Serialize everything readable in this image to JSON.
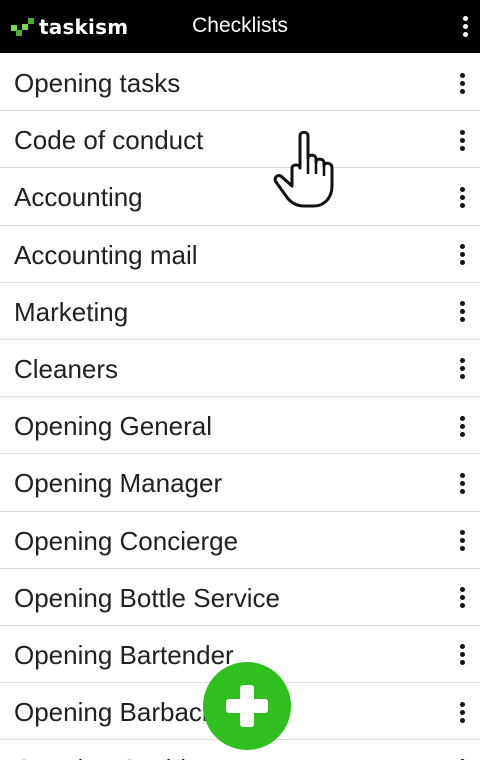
{
  "app": {
    "logo_text": "taskism",
    "title": "Checklists"
  },
  "icons": {
    "top_menu": "vertical-dots-icon",
    "row_menu": "vertical-dots-icon",
    "fab": "plus-icon",
    "pointer": "hand-pointer-icon"
  },
  "colors": {
    "topbar": "#000000",
    "fab": "#2fbf1f",
    "logo_accent": "#7ed957"
  },
  "checklists": [
    {
      "label": "Opening tasks"
    },
    {
      "label": "Code of conduct"
    },
    {
      "label": "Accounting"
    },
    {
      "label": "Accounting mail"
    },
    {
      "label": "Marketing"
    },
    {
      "label": "Cleaners"
    },
    {
      "label": "Opening General"
    },
    {
      "label": "Opening Manager"
    },
    {
      "label": "Opening Concierge"
    },
    {
      "label": "Opening Bottle Service"
    },
    {
      "label": "Opening Bartender"
    },
    {
      "label": "Opening Barback"
    },
    {
      "label": "Opening Cashier"
    }
  ]
}
